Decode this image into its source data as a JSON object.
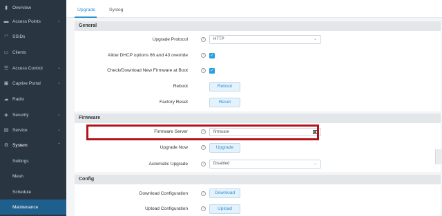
{
  "sidebar": {
    "items": [
      {
        "label": "Overview",
        "icon": "bar-chart-icon"
      },
      {
        "label": "Access Points",
        "icon": "access-point-icon"
      },
      {
        "label": "SSIDs",
        "icon": "wifi-icon"
      },
      {
        "label": "Clients",
        "icon": "monitor-icon"
      },
      {
        "label": "Access Control",
        "icon": "list-icon"
      },
      {
        "label": "Captive Portal",
        "icon": "captive-icon"
      },
      {
        "label": "Radio",
        "icon": "cloud-icon"
      },
      {
        "label": "Security",
        "icon": "shield-icon"
      },
      {
        "label": "Service",
        "icon": "service-icon"
      },
      {
        "label": "System",
        "icon": "gear-icon"
      }
    ],
    "sub_items": [
      {
        "label": "Settings"
      },
      {
        "label": "Mesh"
      },
      {
        "label": "Schedule"
      },
      {
        "label": "Maintenance"
      }
    ]
  },
  "tabs": [
    {
      "label": "Upgrade"
    },
    {
      "label": "Syslog"
    }
  ],
  "general": {
    "title": "General",
    "upgrade_protocol_label": "Upgrade Protocol",
    "upgrade_protocol_value": "HTTP",
    "dhcp_label": "Allow DHCP options 66 and 43 override",
    "check_firmware_label": "Check/Download New Firmware at Boot",
    "reboot_label": "Reboot",
    "reboot_button": "Reboot",
    "factory_reset_label": "Factory Reset",
    "reset_button": "Reset"
  },
  "firmware": {
    "title": "Firmware",
    "server_label": "Firmware Server",
    "server_value": "firmware",
    "upgrade_now_label": "Upgrade Now",
    "upgrade_button": "Upgrade",
    "auto_upgrade_label": "Automatic Upgrade",
    "auto_upgrade_value": "Disabled"
  },
  "config": {
    "title": "Config",
    "download_label": "Download Configuration",
    "download_button": "Download",
    "upload_label": "Upload Configuration",
    "upload_button": "Upload"
  },
  "colors": {
    "sidebar_bg": "#2a3542",
    "active_item": "#1f5f8e",
    "accent": "#2a8fd6",
    "highlight": "#b3121b"
  }
}
